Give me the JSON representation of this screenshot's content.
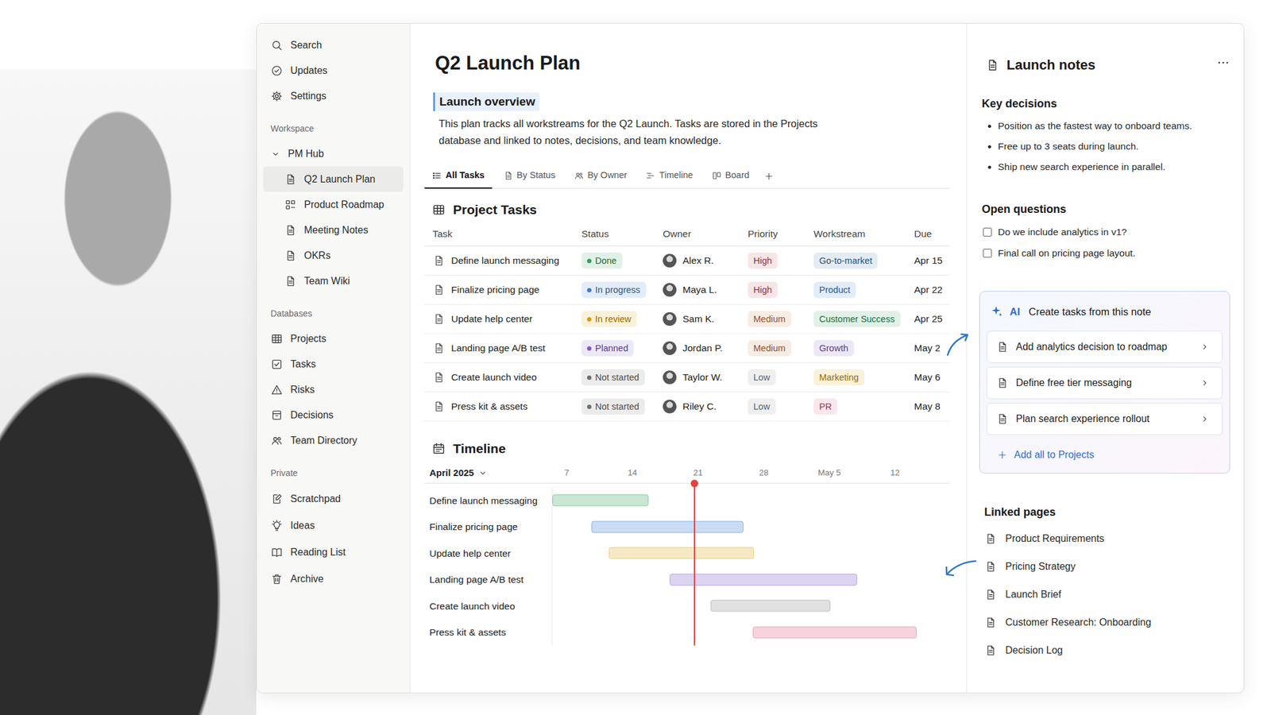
{
  "page": {
    "title": "Q2 Launch Plan",
    "overview": {
      "heading": "Launch overview",
      "text": "This plan tracks all workstreams for the Q2 Launch. Tasks are stored in the Projects database and linked to notes, decisions, and team knowledge."
    }
  },
  "sidebar": {
    "top_items": [
      {
        "label": "Search"
      },
      {
        "label": "Updates"
      },
      {
        "label": "Settings"
      }
    ],
    "workspace": {
      "heading": "Workspace",
      "group": {
        "label": "PM Hub",
        "expanded": true,
        "items": [
          {
            "label": "Q2 Launch Plan",
            "selected": true
          },
          {
            "label": "Product Roadmap",
            "selected": false
          },
          {
            "label": "Meeting Notes",
            "selected": false
          },
          {
            "label": "OKRs",
            "selected": false
          },
          {
            "label": "Team Wiki",
            "selected": false
          }
        ]
      }
    },
    "databases": {
      "heading": "Databases",
      "items": [
        {
          "label": "Projects",
          "selected": false
        },
        {
          "label": "Tasks",
          "selected": false
        },
        {
          "label": "Risks",
          "selected": false
        },
        {
          "label": "Decisions",
          "selected": false
        },
        {
          "label": "Team Directory",
          "selected": false
        }
      ]
    },
    "private": {
      "heading": "Private",
      "items": [
        {
          "label": "Scratchpad",
          "selected": false
        },
        {
          "label": "Ideas",
          "selected": false
        },
        {
          "label": "Reading List",
          "selected": false
        },
        {
          "label": "Archive",
          "selected": false
        }
      ]
    }
  },
  "views": [
    {
      "label": "All Tasks",
      "selected": true
    },
    {
      "label": "By Status",
      "selected": false
    },
    {
      "label": "By Owner",
      "selected": false
    },
    {
      "label": "Timeline",
      "selected": false
    },
    {
      "label": "Board",
      "selected": false
    }
  ],
  "table": {
    "title": "Project Tasks",
    "columns": [
      "Task",
      "Status",
      "Owner",
      "Priority",
      "Workstream",
      "Due"
    ],
    "rows": [
      {
        "task": "Define launch messaging",
        "status": {
          "label": "Done",
          "color": "#2f9e55"
        },
        "owner": "Alex R.",
        "priority": {
          "label": "High",
          "color": "#d04a4a"
        },
        "workstream": {
          "label": "Go-to-market",
          "color": "#3e74a8"
        },
        "due": "Apr 15"
      },
      {
        "task": "Finalize pricing page",
        "status": {
          "label": "In progress",
          "color": "#3a7bd5"
        },
        "owner": "Maya L.",
        "priority": {
          "label": "High",
          "color": "#d04a4a"
        },
        "workstream": {
          "label": "Product",
          "color": "#3a7bd5"
        },
        "due": "Apr 22"
      },
      {
        "task": "Update help center",
        "status": {
          "label": "In review",
          "color": "#d99a00"
        },
        "owner": "Sam K.",
        "priority": {
          "label": "Medium",
          "color": "#d2743a"
        },
        "workstream": {
          "label": "Customer Success",
          "color": "#2f9e55"
        },
        "due": "Apr 25"
      },
      {
        "task": "Landing page A/B test",
        "status": {
          "label": "Planned",
          "color": "#7a5cc8"
        },
        "owner": "Jordan P.",
        "priority": {
          "label": "Medium",
          "color": "#d2743a"
        },
        "workstream": {
          "label": "Growth",
          "color": "#7a5cc8"
        },
        "due": "May 2"
      },
      {
        "task": "Create launch video",
        "status": {
          "label": "Not started",
          "color": "#6f6f6f"
        },
        "owner": "Taylor W.",
        "priority": {
          "label": "Low",
          "color": "#8a8a8a"
        },
        "workstream": {
          "label": "Marketing",
          "color": "#d99a00"
        },
        "due": "May 6"
      },
      {
        "task": "Press kit & assets",
        "status": {
          "label": "Not started",
          "color": "#6f6f6f"
        },
        "owner": "Riley C.",
        "priority": {
          "label": "Low",
          "color": "#8a8a8a"
        },
        "workstream": {
          "label": "PR",
          "color": "#d4567a"
        },
        "due": "May 8"
      }
    ]
  },
  "timeline": {
    "title": "Timeline",
    "month": "April 2025",
    "range": [
      5.4,
      47.8
    ],
    "today": 20.6,
    "ticks": [
      {
        "label": "7",
        "value": 7
      },
      {
        "label": "14",
        "value": 14
      },
      {
        "label": "21",
        "value": 21
      },
      {
        "label": "28",
        "value": 28
      },
      {
        "label": "May 5",
        "value": 35
      },
      {
        "label": "12",
        "value": 42
      }
    ],
    "bars": [
      {
        "label": "Define launch messaging",
        "span": [
          5.4,
          15.7
        ],
        "color": "#4caf6a"
      },
      {
        "label": "Finalize pricing page",
        "span": [
          9.6,
          25.8
        ],
        "color": "#4a8ad8"
      },
      {
        "label": "Update help center",
        "span": [
          11.4,
          26.9
        ],
        "color": "#e3b43a"
      },
      {
        "label": "Landing page A/B test",
        "span": [
          17.9,
          37.9
        ],
        "color": "#8a6fd1"
      },
      {
        "label": "Create launch video",
        "span": [
          22.3,
          35.1
        ],
        "color": "#9a9a9a"
      },
      {
        "label": "Press kit & assets",
        "span": [
          26.8,
          44.3
        ],
        "color": "#e0708e"
      }
    ]
  },
  "notes": {
    "title": "Launch notes",
    "key_decisions": {
      "heading": "Key decisions",
      "items": [
        "Position as the fastest way to onboard teams.",
        "Free up to 3 seats during launch.",
        "Ship new search experience in parallel."
      ]
    },
    "open_questions": {
      "heading": "Open questions",
      "items": [
        {
          "label": "Do we include analytics in v1?",
          "checked": false
        },
        {
          "label": "Final call on pricing page layout.",
          "checked": false
        }
      ]
    },
    "ai": {
      "badge": "AI",
      "title": "Create tasks from this note",
      "suggestions": [
        "Add analytics decision to roadmap",
        "Define free tier messaging",
        "Plan search experience rollout"
      ],
      "action": "Add all to Projects"
    },
    "linked_pages": {
      "heading": "Linked pages",
      "items": [
        "Product Requirements",
        "Pricing Strategy",
        "Launch Brief",
        "Customer Research: Onboarding",
        "Decision Log"
      ]
    }
  }
}
